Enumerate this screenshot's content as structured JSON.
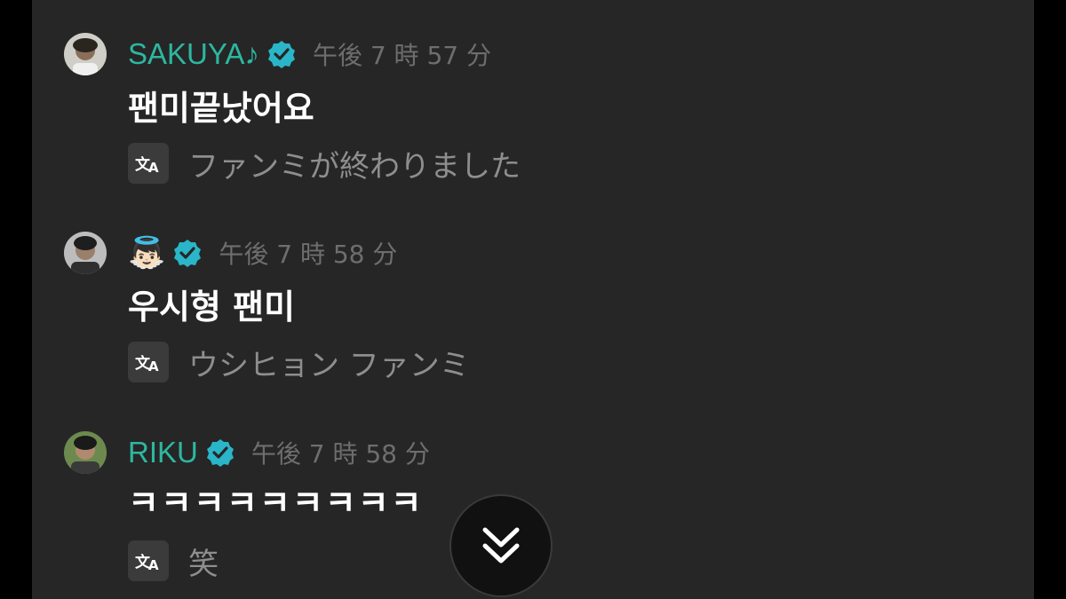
{
  "messages": [
    {
      "sender": "SAKUYA♪",
      "verified": true,
      "time": "午後 7 時 57 分",
      "text": "팬미끝났어요",
      "translation": "ファンミが終わりました"
    },
    {
      "sender": "👼🏻",
      "verified": true,
      "time": "午後 7 時 58 分",
      "text": "우시형 팬미",
      "translation": "ウシヒョン ファンミ"
    },
    {
      "sender": "RIKU",
      "verified": true,
      "time": "午後 7 時 58 分",
      "text": "ㅋㅋㅋㅋㅋㅋㅋㅋㅋ",
      "translation": "笑"
    }
  ],
  "icons": {
    "verified": "verified-badge-icon",
    "translate": "translate-icon",
    "scroll": "double-chevron-down-icon"
  },
  "colors": {
    "background": "#262626",
    "sender_name": "#2db7a0",
    "verified_badge": "#2ab6c8",
    "timestamp": "#6e6e6e",
    "message_text": "#ffffff",
    "translation_text": "#8e8e8e"
  }
}
